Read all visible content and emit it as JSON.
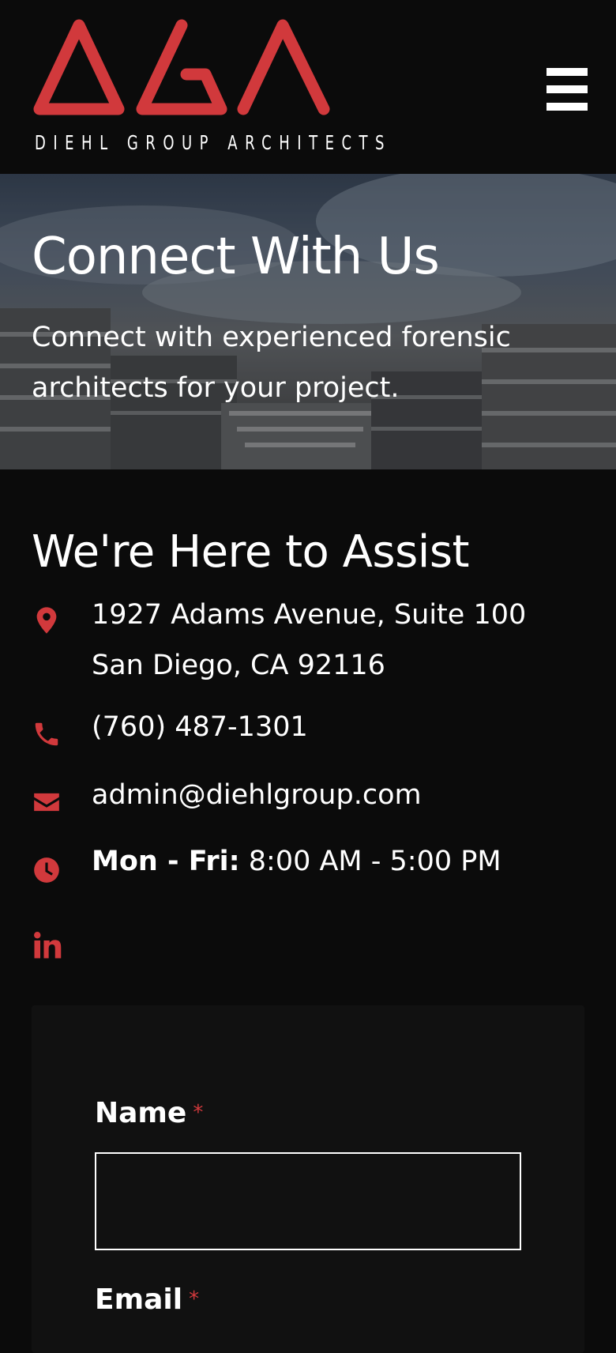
{
  "brand": {
    "name": "DIEHL GROUP ARCHITECTS",
    "accent_color": "#d1393c",
    "logo_icon": "dga-triangles-logo"
  },
  "header": {
    "menu_icon": "hamburger-menu-icon"
  },
  "hero": {
    "title": "Connect With Us",
    "subtitle": "Connect with experienced forensic architects for your project."
  },
  "contact": {
    "title": "We're Here to Assist",
    "address_line1": "1927 Adams Avenue, Suite 100",
    "address_line2": "San Diego, CA 92116",
    "phone": "(760) 487-1301",
    "email": "admin@diehlgroup.com",
    "hours_label": "Mon - Fri:",
    "hours_value": "8:00 AM - 5:00 PM",
    "social_icon": "linkedin-icon"
  },
  "form": {
    "name_label": "Name",
    "email_label": "Email",
    "required_marker": "*",
    "name_value": "",
    "email_value": ""
  }
}
